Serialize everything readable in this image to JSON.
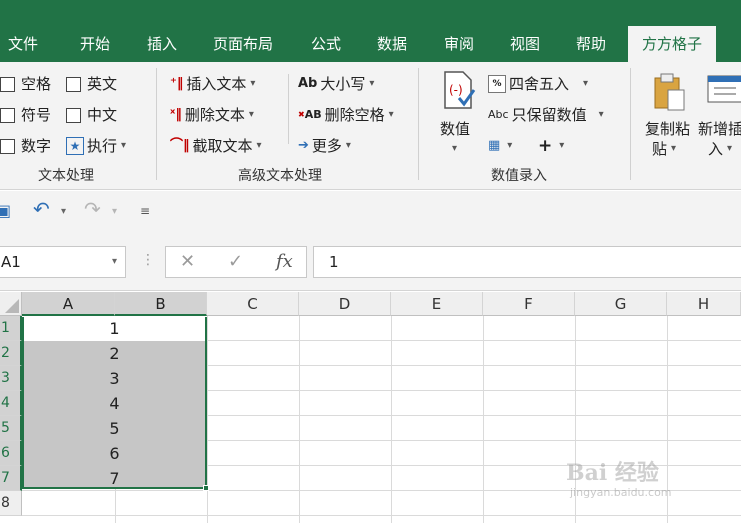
{
  "tabs": [
    {
      "label": "文件"
    },
    {
      "label": "开始"
    },
    {
      "label": "插入"
    },
    {
      "label": "页面布局"
    },
    {
      "label": "公式"
    },
    {
      "label": "数据"
    },
    {
      "label": "审阅"
    },
    {
      "label": "视图"
    },
    {
      "label": "帮助"
    },
    {
      "label": "方方格子"
    }
  ],
  "active_tab": "方方格子",
  "ribbon": {
    "text_group": {
      "label": "文本处理",
      "items": [
        "空格",
        "英文",
        "符号",
        "中文",
        "数字",
        "执行"
      ]
    },
    "advanced_group": {
      "label": "高级文本处理",
      "insert_text": "插入文本",
      "delete_text": "删除文本",
      "cut_text": "截取文本",
      "case": "大小写",
      "delete_space": "删除空格",
      "more": "更多"
    },
    "number_group": {
      "label": "数值录入",
      "number_btn": "数值",
      "round": "四舍五入",
      "keep_value": "只保留数值"
    },
    "paste_group": {
      "copy_paste": "复制粘",
      "copy_paste2": "贴",
      "new_insert": "新增插",
      "new_insert2": "入"
    },
    "icon_text": {
      "ab": "Ab",
      "ab_small": "AB",
      "abc": "Abc",
      "plus": "+"
    }
  },
  "formula_bar": {
    "name_box": "A1",
    "fx": "fx",
    "value": "1"
  },
  "grid": {
    "columns": [
      "A",
      "B",
      "C",
      "D",
      "E",
      "F",
      "G",
      "H"
    ],
    "rows": [
      "1",
      "2",
      "3",
      "4",
      "5",
      "6",
      "7",
      "8"
    ],
    "merged_values": [
      "1",
      "2",
      "3",
      "4",
      "5",
      "6",
      "7"
    ]
  },
  "watermark": {
    "text": "Bai 经验",
    "sub": "jingyan.baidu.com"
  },
  "colors": {
    "accent": "#217346",
    "ribbon_bg": "#f3f3f3",
    "selection_fill": "#c6c6c6"
  }
}
